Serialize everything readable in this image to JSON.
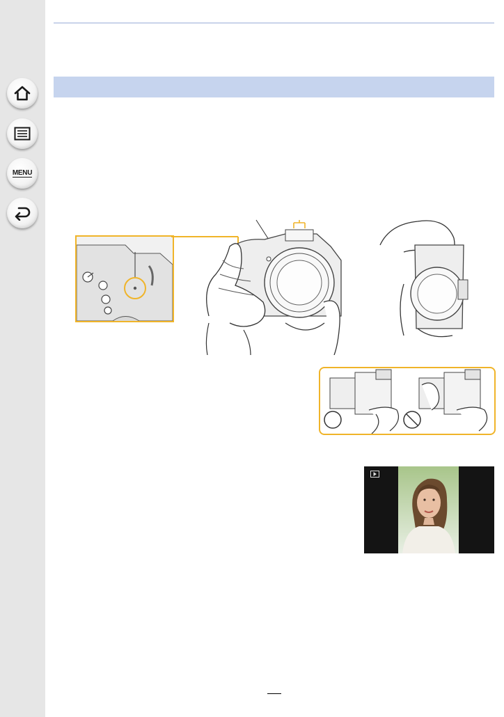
{
  "sidebar": {
    "items": [
      {
        "icon": "home-icon"
      },
      {
        "icon": "contents-list-icon"
      },
      {
        "icon": "menu-icon",
        "label": "MENU"
      },
      {
        "icon": "back-icon"
      }
    ]
  },
  "section": {
    "title": ""
  },
  "colors": {
    "sidebar": "#e6e6e6",
    "section_bar": "#c6d4ee",
    "highlight_frame": "#f0b429"
  }
}
